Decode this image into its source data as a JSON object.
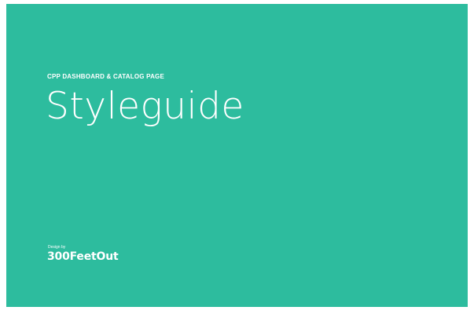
{
  "colors": {
    "background": "#2dbc9e",
    "text": "#ffffff"
  },
  "cover": {
    "subtitle": "CPP DASHBOARD & CATALOG PAGE",
    "title": "Styleguide",
    "credit_label": "Design by",
    "credit_brand": "300FeetOut"
  }
}
